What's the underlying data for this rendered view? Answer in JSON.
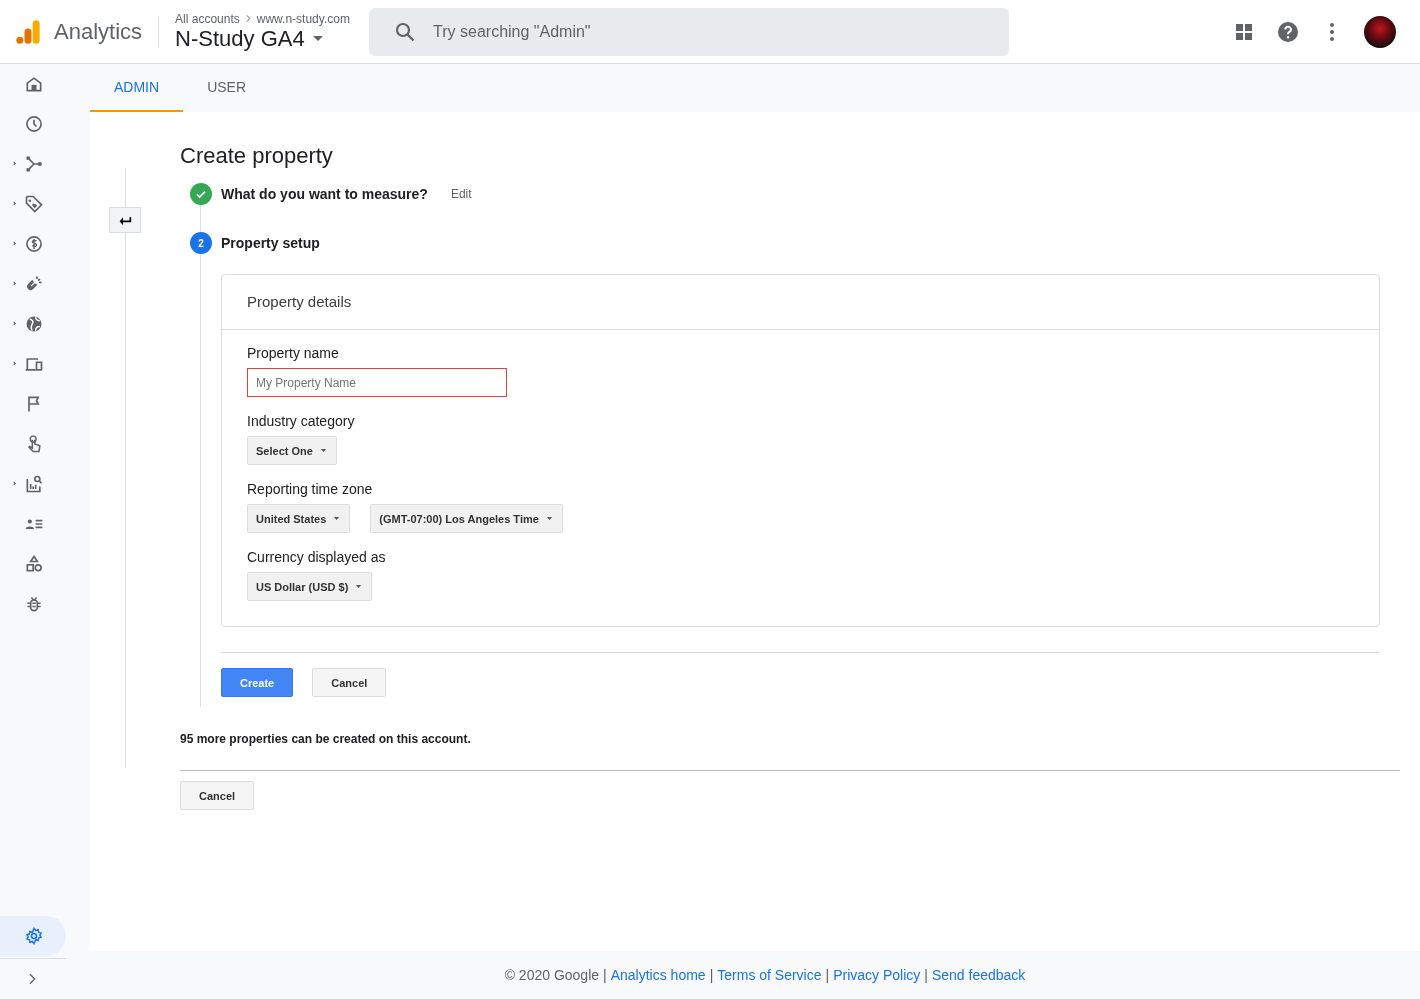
{
  "header": {
    "product": "Analytics",
    "breadcrumb": [
      {
        "label": "All accounts"
      },
      {
        "label": "www.n-study.com"
      }
    ],
    "property": "N-Study GA4",
    "search": {
      "placeholder": "Try searching \"Admin\""
    }
  },
  "sidebar": {
    "items": [
      {
        "expandable": false,
        "selected": false
      },
      {
        "expandable": false,
        "selected": false
      },
      {
        "expandable": true,
        "selected": false
      },
      {
        "expandable": true,
        "selected": false
      },
      {
        "expandable": true,
        "selected": false
      },
      {
        "expandable": true,
        "selected": false
      },
      {
        "expandable": true,
        "selected": false
      },
      {
        "expandable": true,
        "selected": false
      },
      {
        "expandable": false,
        "selected": false
      },
      {
        "expandable": false,
        "selected": false
      },
      {
        "expandable": true,
        "selected": false
      },
      {
        "expandable": false,
        "selected": false
      },
      {
        "expandable": false,
        "selected": false
      },
      {
        "expandable": false,
        "selected": false
      }
    ],
    "settings": {
      "selected": true
    }
  },
  "tabs": [
    {
      "label": "ADMIN",
      "selected": true
    },
    {
      "label": "USER",
      "selected": false
    }
  ],
  "page": {
    "title": "Create property",
    "steps": [
      {
        "completed": true,
        "label": "What do you want to measure?",
        "action": "Edit"
      },
      {
        "completed": false,
        "number": "2",
        "label": "Property setup"
      }
    ],
    "card": {
      "title": "Property details",
      "fields": [
        {
          "kind": "text",
          "label": "Property name",
          "placeholder": "My Property Name",
          "invalid": true
        },
        {
          "kind": "select",
          "label": "Industry category",
          "selects": [
            {
              "value": "Select One"
            }
          ]
        },
        {
          "kind": "select",
          "label": "Reporting time zone",
          "selects": [
            {
              "value": "United States"
            },
            {
              "value": "(GMT-07:00) Los Angeles Time"
            }
          ]
        },
        {
          "kind": "select",
          "label": "Currency displayed as",
          "selects": [
            {
              "value": "US Dollar (USD $)"
            }
          ]
        }
      ]
    },
    "buttons": [
      {
        "label": "Create",
        "kind": "primary"
      },
      {
        "label": "Cancel",
        "kind": "secondary"
      }
    ],
    "note": "95 more properties can be created on this account.",
    "bottom_button": "Cancel"
  },
  "footer": {
    "copyright": "© 2020 Google",
    "separator": "|",
    "links": [
      {
        "label": "Analytics home"
      },
      {
        "label": "Terms of Service"
      },
      {
        "label": "Privacy Policy"
      },
      {
        "label": "Send feedback"
      }
    ]
  }
}
